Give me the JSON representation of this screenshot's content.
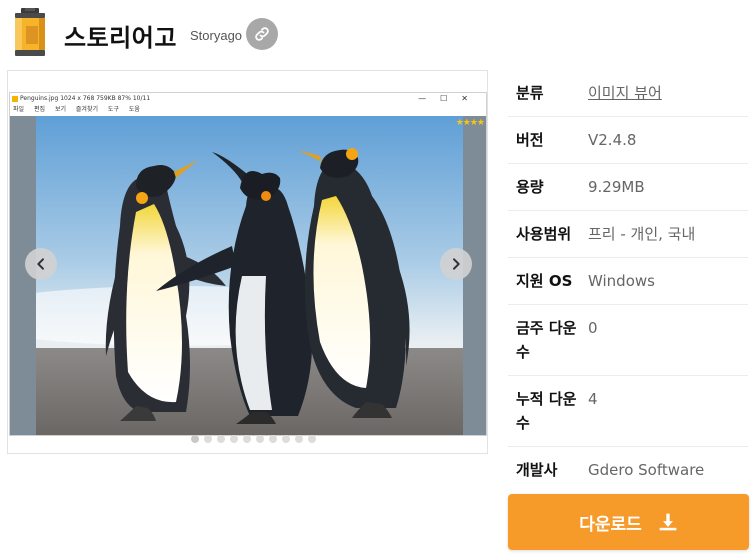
{
  "header": {
    "title": "스토리어고",
    "subtitle": "Storyago",
    "app_icon": "film-canister-icon",
    "link_icon": "link-icon"
  },
  "gallery": {
    "window": {
      "title": "Penguins.jpg  1024 x 768  759KB  87%   10/11",
      "controls": [
        "—",
        "☐",
        "✕"
      ],
      "menu": [
        "파일",
        "편집",
        "보기",
        "즐겨찾기",
        "도구",
        "도움"
      ],
      "rating": "★★★★"
    },
    "prev_icon": "chevron-left-icon",
    "next_icon": "chevron-right-icon",
    "slide_count": 10,
    "active_slide": 0
  },
  "info": {
    "rows": [
      {
        "label": "분류",
        "value": "이미지 뷰어"
      },
      {
        "label": "버전",
        "value": "V2.4.8"
      },
      {
        "label": "용량",
        "value": "9.29MB"
      },
      {
        "label": "사용범위",
        "value": "프리 - 개인, 국내"
      },
      {
        "label": "지원 OS",
        "value": "Windows"
      },
      {
        "label": "금주 다운수",
        "value": "0"
      },
      {
        "label": "누적 다운수",
        "value": "4"
      },
      {
        "label": "개발사",
        "value": "Gdero Software"
      }
    ]
  },
  "download": {
    "label": "다운로드",
    "icon": "download-icon"
  },
  "colors": {
    "accent": "#f69a2a",
    "link_button": "#a8a8a8"
  }
}
